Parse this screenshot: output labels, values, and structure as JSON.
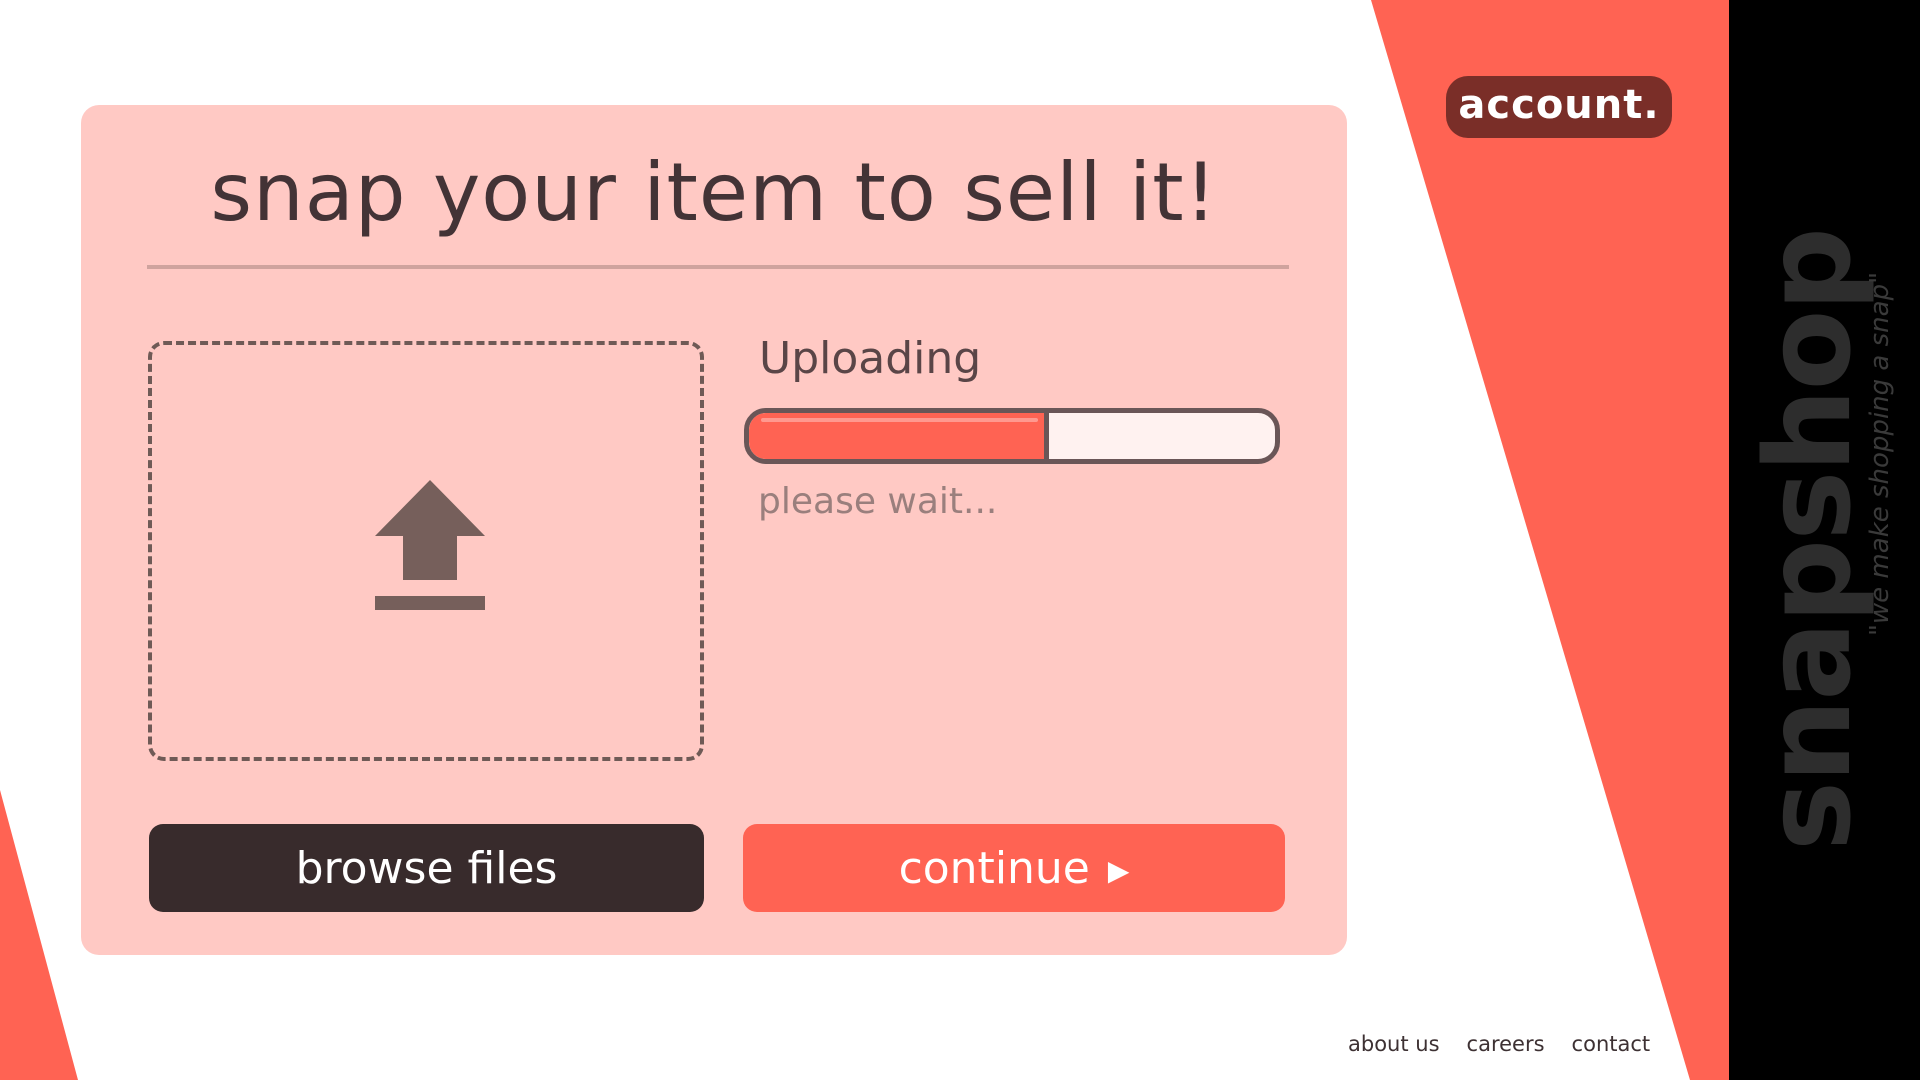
{
  "app": {
    "brand_name": "snapshop",
    "brand_tagline": "\"we make shopping a snap\"",
    "account_label": "account."
  },
  "upload_card": {
    "title": "snap your item to sell it!",
    "status_label": "Uploading",
    "status_subtext": "please wait...",
    "progress_fraction": 0.57,
    "browse_label": "browse files",
    "continue_label": "continue"
  },
  "icons": {
    "upload": "upload-arrow-icon",
    "continue": "play-triangle-icon"
  },
  "footer": {
    "links": [
      "about us",
      "careers",
      "contact"
    ]
  },
  "colors": {
    "accent_coral": "#ff6353",
    "card_pink": "#ffc9c4",
    "dark_button": "#382b2c",
    "account_badge": "#7a2e28",
    "brand_strip": "#000000"
  }
}
